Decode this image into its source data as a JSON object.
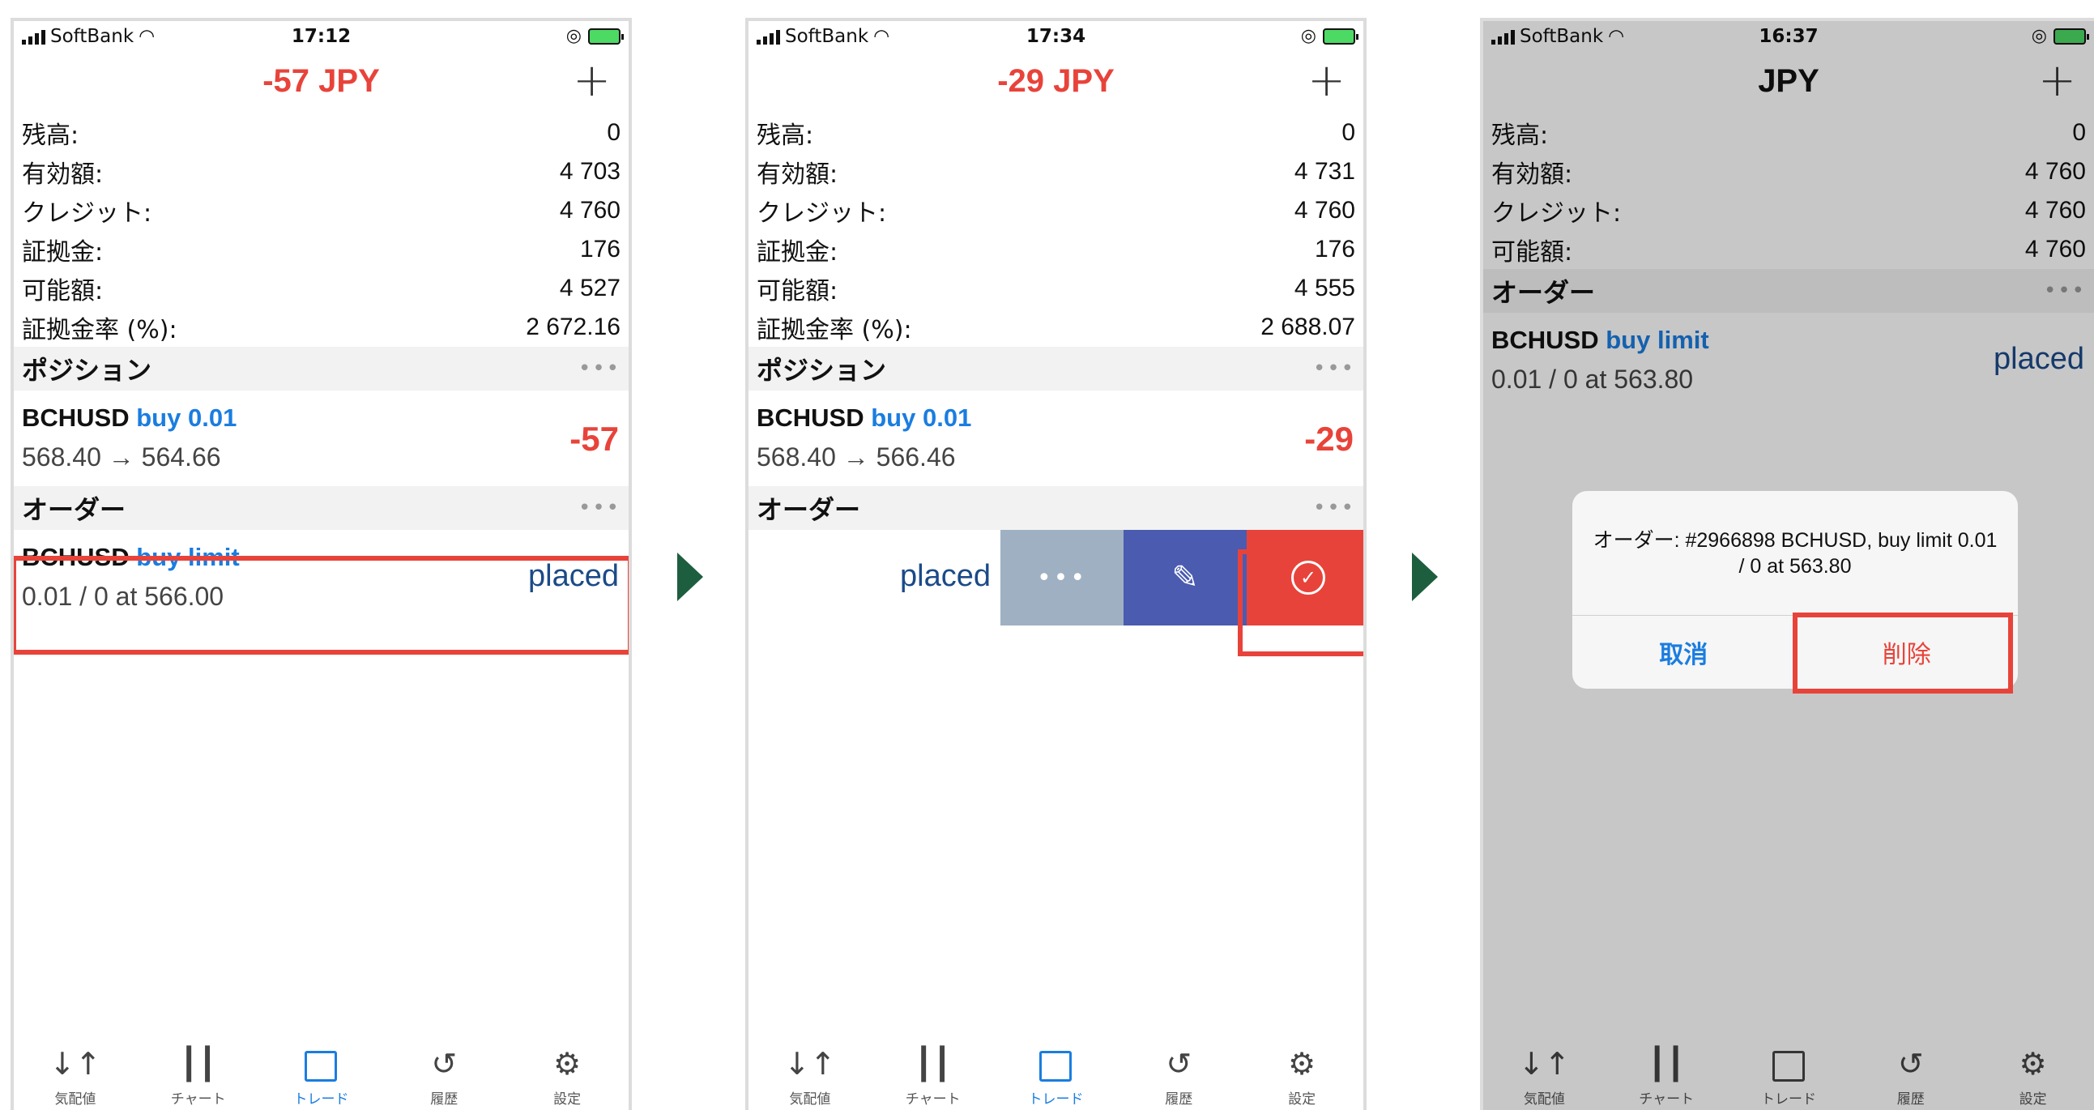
{
  "screens": [
    {
      "carrier": "SoftBank",
      "time": "17:12",
      "title": "-57 JPY",
      "stats": [
        {
          "label": "残高:",
          "value": "0"
        },
        {
          "label": "有効額:",
          "value": "4 703"
        },
        {
          "label": "クレジット:",
          "value": "4 760"
        },
        {
          "label": "証拠金:",
          "value": "176"
        },
        {
          "label": "可能額:",
          "value": "4 527"
        },
        {
          "label": "証拠金率 (%):",
          "value": "2 672.16"
        }
      ],
      "positions_label": "ポジション",
      "position": {
        "symbol": "BCHUSD",
        "side": "buy 0.01",
        "prices": "568.40 → 564.66",
        "profit": "-57"
      },
      "orders_label": "オーダー",
      "order": {
        "symbol": "BCHUSD",
        "type": "buy limit",
        "detail": "0.01 / 0 at 566.00",
        "status": "placed"
      }
    },
    {
      "carrier": "SoftBank",
      "time": "17:34",
      "title": "-29 JPY",
      "stats": [
        {
          "label": "残高:",
          "value": "0"
        },
        {
          "label": "有効額:",
          "value": "4 731"
        },
        {
          "label": "クレジット:",
          "value": "4 760"
        },
        {
          "label": "証拠金:",
          "value": "176"
        },
        {
          "label": "可能額:",
          "value": "4 555"
        },
        {
          "label": "証拠金率 (%):",
          "value": "2 688.07"
        }
      ],
      "positions_label": "ポジション",
      "position": {
        "symbol": "BCHUSD",
        "side": "buy 0.01",
        "prices": "568.40 → 566.46",
        "profit": "-29"
      },
      "orders_label": "オーダー",
      "order": {
        "status": "placed"
      }
    },
    {
      "carrier": "SoftBank",
      "time": "16:37",
      "title": "JPY",
      "stats": [
        {
          "label": "残高:",
          "value": "0"
        },
        {
          "label": "有効額:",
          "value": "4 760"
        },
        {
          "label": "クレジット:",
          "value": "4 760"
        },
        {
          "label": "可能額:",
          "value": "4 760"
        }
      ],
      "orders_label": "オーダー",
      "order": {
        "symbol": "BCHUSD",
        "type": "buy limit",
        "detail": "0.01 / 0 at 563.80",
        "status": "placed"
      },
      "dialog": {
        "message": "オーダー: #2966898 BCHUSD, buy limit 0.01 / 0 at 563.80",
        "cancel": "取消",
        "delete": "削除"
      }
    }
  ],
  "tabs": [
    {
      "icon": "quotes-icon",
      "glyph": "↓↑",
      "label": "気配値"
    },
    {
      "icon": "chart-icon",
      "glyph": "┃┃",
      "label": "チャート"
    },
    {
      "icon": "trade-icon",
      "glyph": "",
      "label": "トレード"
    },
    {
      "icon": "history-icon",
      "glyph": "↺",
      "label": "履歴"
    },
    {
      "icon": "settings-icon",
      "glyph": "⚙",
      "label": "設定"
    }
  ],
  "dots": "•••",
  "plus": "+",
  "colors": {
    "accent": "#1a7de0",
    "loss": "#e8433a",
    "edit": "#4a5bb0",
    "more": "#9fb0c2",
    "arrow": "#1d5e3e"
  }
}
